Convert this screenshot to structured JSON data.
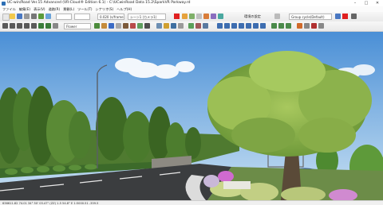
{
  "window": {
    "title": "UC-win/Road Ver.15 Advanced (VR-Cloud® Edition 6.1) - C:\\UCwinRoad Data 15.2\\SparkVR Parkway.rd",
    "minimize": "–",
    "maximize": "□",
    "close": "✕"
  },
  "menu": [
    "ファイル",
    "編集(E)",
    "表示(V)",
    "道路(R)",
    "景観(L)",
    "ツール(T)",
    "シナリオ(S)",
    "ヘルプ(H)"
  ],
  "toolbar1": {
    "speed_value": "0.020 (s/frame)",
    "view_field": "シーン1 (カメラ1)",
    "settings_label": "環境の設定",
    "group_select": "Group cycle(Default)"
  },
  "toolbar2": {
    "layer_select": "Flower"
  },
  "status": {
    "text": "636611.82 74.01   34°  50' 03.47\"  (ZZ)  1.5  54.8°  E  1:5000.51  -359.5"
  },
  "colors": {
    "sky_top": "#4a8fd6",
    "sky_bottom": "#c9e1f3",
    "grass": "#4f7a30",
    "road": "#3b3d3f",
    "tree_foliage": "#8fb64a",
    "brand_red": "#e02020"
  },
  "icons": [
    "new-file-icon",
    "open-icon",
    "save-icon",
    "play-icon",
    "stop-icon",
    "camera-icon",
    "road-icon",
    "tree-icon",
    "zoom-icon",
    "grid-icon"
  ]
}
